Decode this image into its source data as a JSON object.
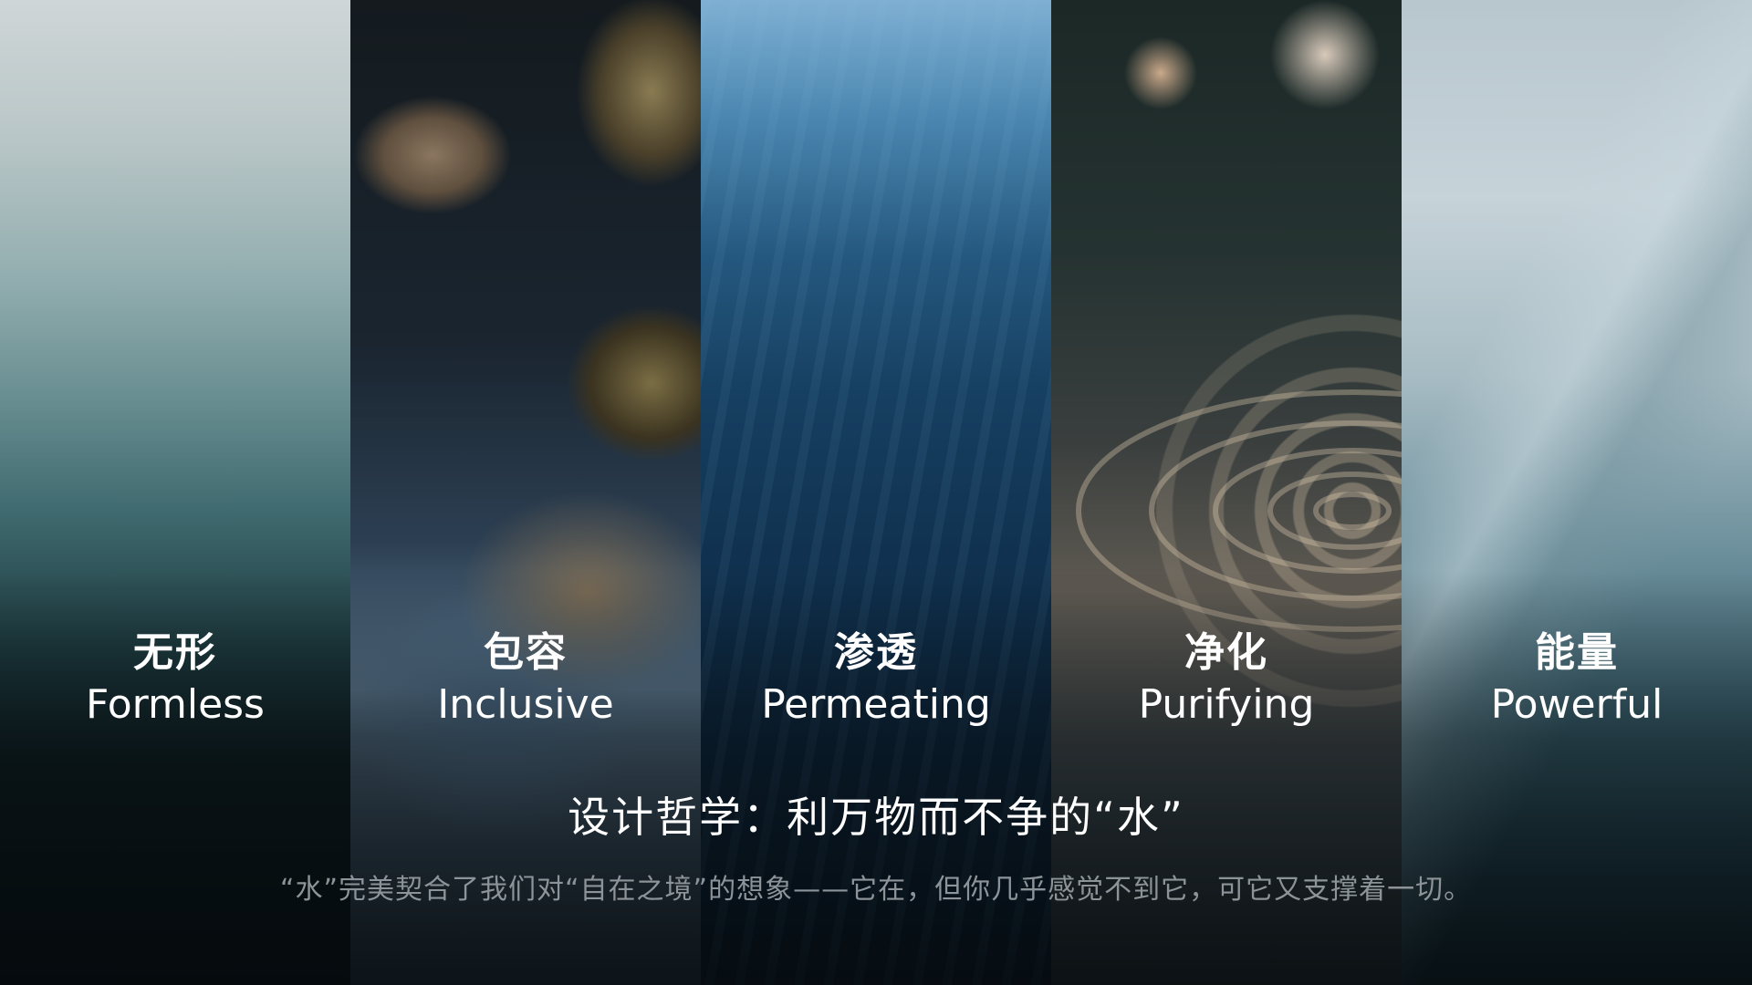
{
  "panels": [
    {
      "zh": "无形",
      "en": "Formless",
      "image": "calm-water-surface"
    },
    {
      "zh": "包容",
      "en": "Inclusive",
      "image": "stream-over-rocks"
    },
    {
      "zh": "渗透",
      "en": "Permeating",
      "image": "underwater-light-rays"
    },
    {
      "zh": "净化",
      "en": "Purifying",
      "image": "water-ripples"
    },
    {
      "zh": "能量",
      "en": "Powerful",
      "image": "breaking-wave"
    }
  ],
  "title": "设计哲学：利万物而不争的“水”",
  "subtitle": "“水”完美契合了我们对“自在之境”的想象——它在，但你几乎感觉不到它，可它又支撑着一切。",
  "colors": {
    "title_text": "#ffffff",
    "subtitle_text": "#8d9499"
  }
}
